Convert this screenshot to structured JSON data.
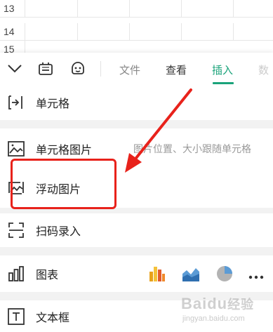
{
  "sheet": {
    "rows": [
      "13",
      "14",
      "15"
    ]
  },
  "toolbar": {
    "tabs": [
      {
        "label": "文件"
      },
      {
        "label": "查看"
      },
      {
        "label": "插入"
      },
      {
        "label": "数"
      }
    ],
    "active_tab": "插入",
    "accent_color": "#1aa37a"
  },
  "menu": {
    "items": [
      {
        "label": "单元格",
        "icon": "insert-cell-icon"
      },
      {
        "label": "单元格图片",
        "hint": "图片位置、大小跟随单元格",
        "icon": "cell-image-icon"
      },
      {
        "label": "浮动图片",
        "icon": "floating-image-icon"
      },
      {
        "label": "扫码录入",
        "icon": "scan-icon"
      },
      {
        "label": "图表",
        "icon": "chart-icon"
      },
      {
        "label": "文本框",
        "icon": "textbox-icon"
      }
    ],
    "chart_types": [
      "bar-chart-icon",
      "area-chart-icon",
      "pie-chart-icon",
      "more-icon"
    ]
  },
  "annotation": {
    "highlight_color": "#e8221b"
  },
  "watermark": {
    "brand": "Baidu",
    "suffix": "经验",
    "url": "jingyan.baidu.com"
  }
}
